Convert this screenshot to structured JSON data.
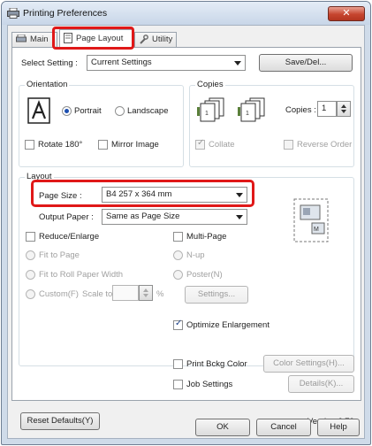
{
  "window": {
    "title": "Printing Preferences",
    "close_label": "✕"
  },
  "tabs": [
    {
      "label": "Main"
    },
    {
      "label": "Page Layout"
    },
    {
      "label": "Utility"
    }
  ],
  "select_setting": {
    "label": "Select Setting :",
    "value": "Current Settings",
    "save_button": "Save/Del..."
  },
  "orientation": {
    "title": "Orientation",
    "portrait": "Portrait",
    "landscape": "Landscape",
    "selected": "Portrait",
    "rotate180": "Rotate 180°",
    "mirror_image": "Mirror Image"
  },
  "copies": {
    "title": "Copies",
    "copies_label": "Copies :",
    "copies_value": "1",
    "collate": "Collate",
    "reverse_order": "Reverse Order"
  },
  "layout": {
    "title": "Layout",
    "page_size_label": "Page Size :",
    "page_size_value": "B4 257 x 364 mm",
    "output_paper_label": "Output Paper :",
    "output_paper_value": "Same as Page Size",
    "reduce_enlarge": "Reduce/Enlarge",
    "fit_to_page": "Fit to Page",
    "fit_to_roll": "Fit to Roll Paper Width",
    "custom": "Custom(F)",
    "scale_to": "Scale to",
    "percent": "%",
    "multi_page": "Multi-Page",
    "n_up": "N-up",
    "poster": "Poster(N)",
    "settings_button": "Settings..."
  },
  "options": {
    "optimize_enlargement": "Optimize Enlargement",
    "print_bckg_color": "Print Bckg Color",
    "color_settings_button": "Color Settings(H)...",
    "job_settings": "Job Settings",
    "details_button": "Details(K)..."
  },
  "footer": {
    "reset_defaults": "Reset Defaults(Y)",
    "version": "Version 6.70"
  },
  "dialog_buttons": {
    "ok": "OK",
    "cancel": "Cancel",
    "help": "Help"
  },
  "colors": {
    "highlight": "#e01818",
    "accent": "#1d4fb0"
  }
}
